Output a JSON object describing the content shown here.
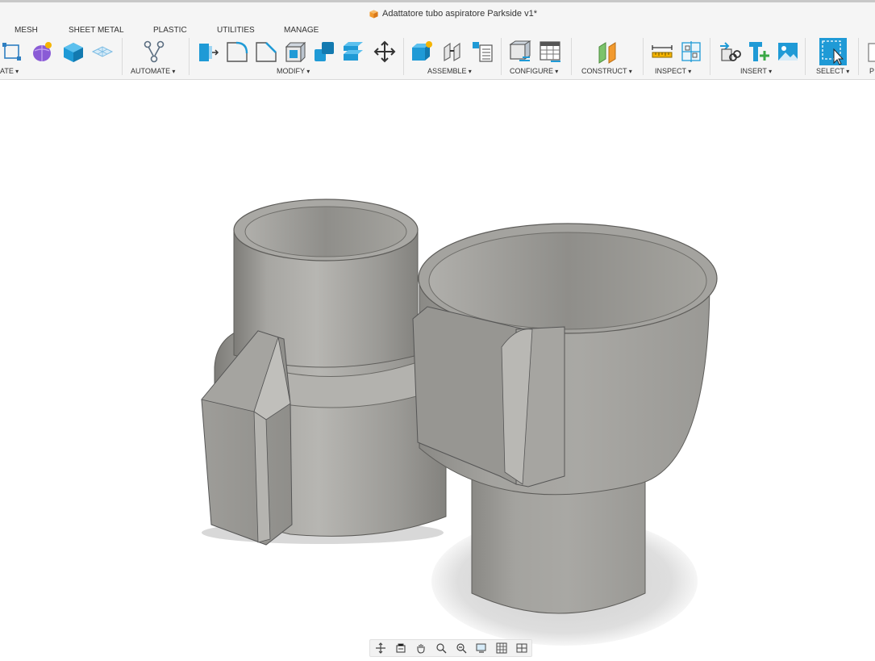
{
  "app": {
    "document_title": "Adattatore tubo aspiratore Parkside v1*",
    "title_icon": "orange-cube-icon"
  },
  "tabs": [
    "MESH",
    "SHEET METAL",
    "PLASTIC",
    "UTILITIES",
    "MANAGE"
  ],
  "groups": {
    "create": "ATE",
    "automate": "AUTOMATE",
    "modify": "MODIFY",
    "assemble": "ASSEMBLE",
    "configure": "CONFIGURE",
    "construct": "CONSTRUCT",
    "inspect": "INSPECT",
    "insert": "INSERT",
    "select": "SELECT",
    "position": "P"
  },
  "icons": {
    "create": [
      "sketch-icon",
      "form-icon",
      "box-icon",
      "plane-mesh-icon"
    ],
    "automate": [
      "automate-icon"
    ],
    "modify": [
      "press-pull-icon",
      "fillet-icon",
      "chamfer-icon",
      "shell-icon",
      "combine-icon",
      "offset-face-icon",
      "move-icon"
    ],
    "assemble": [
      "new-component-icon",
      "joint-icon",
      "bill-of-materials-icon"
    ],
    "configure": [
      "configure-icon",
      "configuration-table-icon"
    ],
    "construct": [
      "offset-plane-icon"
    ],
    "inspect": [
      "measure-icon",
      "section-analysis-icon"
    ],
    "insert": [
      "insert-derive-icon",
      "insert-mcmaster-icon",
      "insert-canvas-icon"
    ],
    "select": [
      "select-icon"
    ]
  },
  "navbar": [
    "orbit-icon",
    "look-at-icon",
    "pan-icon",
    "zoom-icon",
    "fit-icon",
    "display-settings-icon",
    "grid-icon",
    "viewports-icon"
  ],
  "colors": {
    "ribbon_bg": "#f5f5f5",
    "accent_blue": "#1f9ad6",
    "model_gray": "#9b9a96",
    "orange": "#f29a2e"
  }
}
